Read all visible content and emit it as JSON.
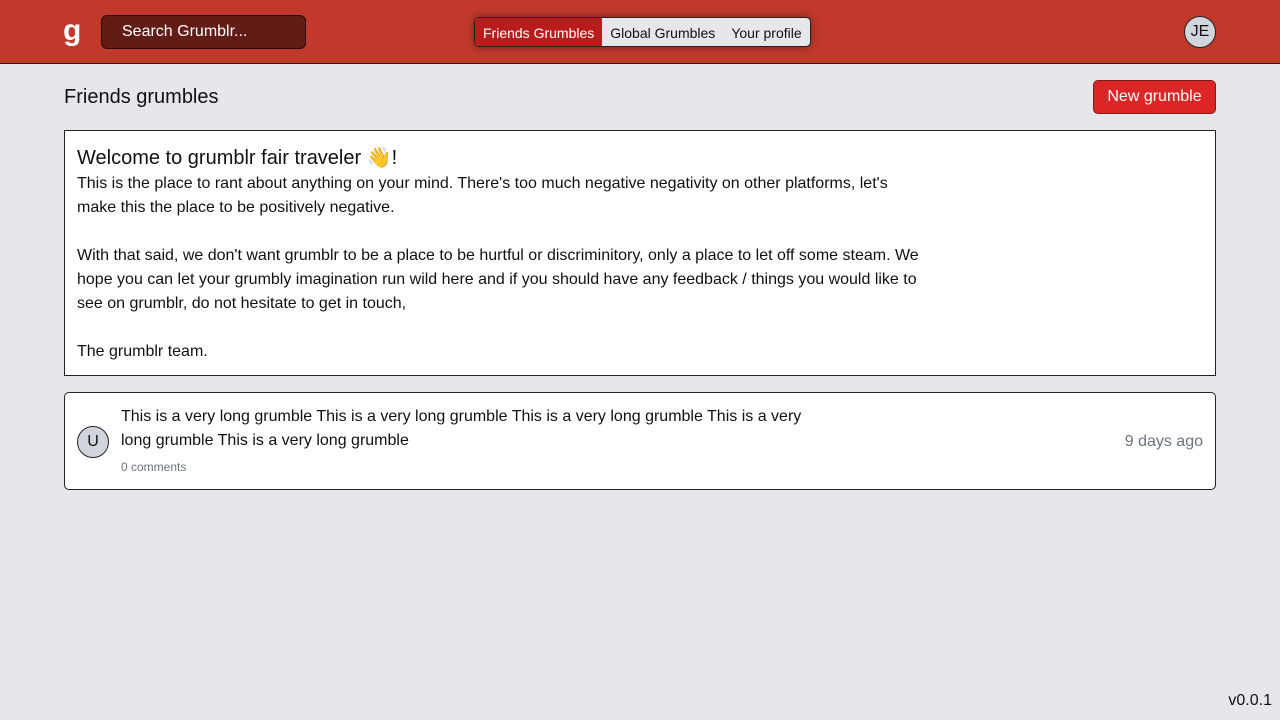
{
  "header": {
    "logo": "g",
    "search_placeholder": "Search Grumblr...",
    "tabs": [
      {
        "label": "Friends Grumbles",
        "active": true
      },
      {
        "label": "Global Grumbles"
      },
      {
        "label": "Your profile"
      }
    ],
    "avatar_initials": "JE"
  },
  "page": {
    "title": "Friends grumbles",
    "new_button": "New grumble"
  },
  "welcome": {
    "heading": "Welcome to grumblr fair traveler 👋!",
    "paragraphs": [
      "This is the place to rant about anything on your mind. There's too much negative negativity on other platforms, let's make this the place to be positively negative.",
      "With that said, we don't want grumblr to be a place to be hurtful or discriminitory, only a place to let off some steam. We hope you can let your grumbly imagination run wild here and if you should have any feedback / things you would like to see on grumblr, do not hesitate to get in touch,",
      "The grumblr team."
    ]
  },
  "grumbles": [
    {
      "avatar": "U",
      "text": "This is a very long grumble This is a very long grumble This is a very long grumble This is a very long grumble This is a very long grumble",
      "comments": "0 comments",
      "time": "9 days ago"
    }
  ],
  "version": "v0.0.1",
  "colors": {
    "header": "#c0392b",
    "accent": "#dc2626"
  }
}
